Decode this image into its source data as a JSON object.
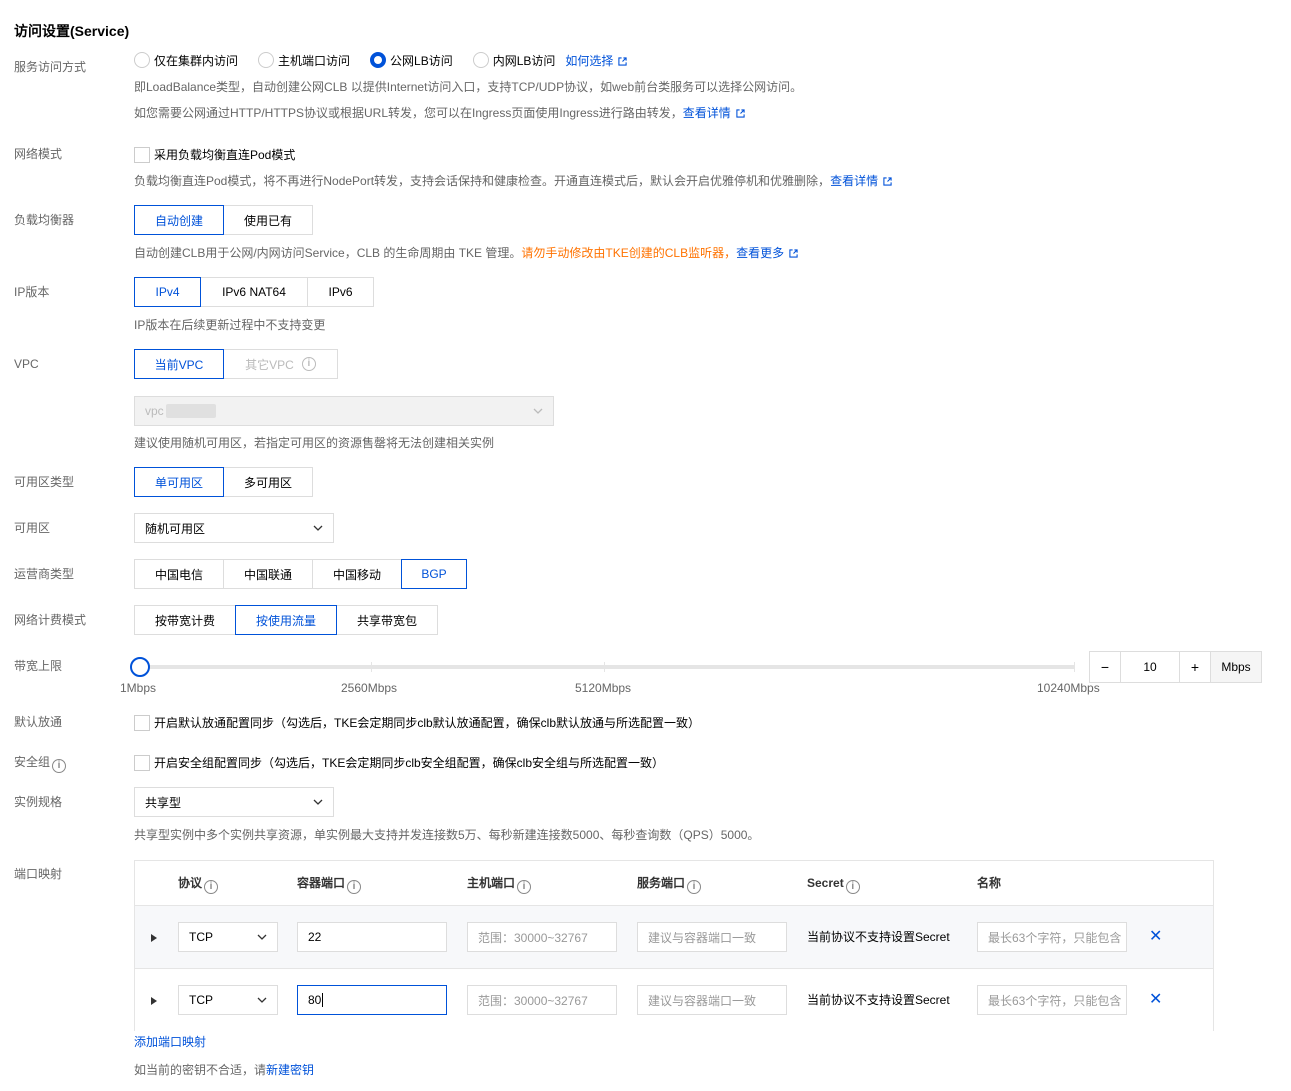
{
  "section_title": "访问设置(Service)",
  "labels": {
    "access_mode": "服务访问方式",
    "network_mode": "网络模式",
    "load_balancer": "负载均衡器",
    "ip_version": "IP版本",
    "vpc": "VPC",
    "zone_type": "可用区类型",
    "zone": "可用区",
    "isp_type": "运营商类型",
    "billing_mode": "网络计费模式",
    "bandwidth_limit": "带宽上限",
    "default_allow": "默认放通",
    "security_group": "安全组",
    "instance_spec": "实例规格",
    "port_mapping": "端口映射"
  },
  "access_mode": {
    "options": [
      "仅在集群内访问",
      "主机端口访问",
      "公网LB访问",
      "内网LB访问"
    ],
    "selected_index": 2,
    "help_link": "如何选择",
    "desc1": "即LoadBalance类型，自动创建公网CLB 以提供Internet访问入口，支持TCP/UDP协议，如web前台类服务可以选择公网访问。",
    "desc2": "如您需要公网通过HTTP/HTTPS协议或根据URL转发，您可以在Ingress页面使用Ingress进行路由转发，",
    "desc2_link": "查看详情"
  },
  "network_mode": {
    "checkbox_label": "采用负载均衡直连Pod模式",
    "desc": "负载均衡直连Pod模式，将不再进行NodePort转发，支持会话保持和健康检查。开通直连模式后，默认会开启优雅停机和优雅删除，",
    "desc_link": "查看详情"
  },
  "load_balancer": {
    "options": [
      "自动创建",
      "使用已有"
    ],
    "selected_index": 0,
    "desc": "自动创建CLB用于公网/内网访问Service，CLB 的生命周期由 TKE 管理。",
    "warning": "请勿手动修改由TKE创建的CLB监听器，",
    "desc_link": "查看更多"
  },
  "ip_version": {
    "options": [
      "IPv4",
      "IPv6 NAT64",
      "IPv6"
    ],
    "selected_index": 0,
    "desc": "IP版本在后续更新过程中不支持变更"
  },
  "vpc": {
    "options": [
      "当前VPC",
      "其它VPC"
    ],
    "selected_index": 0,
    "select_value_prefix": "vpc",
    "desc": "建议使用随机可用区，若指定可用区的资源售罄将无法创建相关实例"
  },
  "zone_type": {
    "options": [
      "单可用区",
      "多可用区"
    ],
    "selected_index": 0
  },
  "zone": {
    "value": "随机可用区"
  },
  "isp_type": {
    "options": [
      "中国电信",
      "中国联通",
      "中国移动",
      "BGP"
    ],
    "selected_index": 3
  },
  "billing_mode": {
    "options": [
      "按带宽计费",
      "按使用流量",
      "共享带宽包"
    ],
    "selected_index": 1
  },
  "bandwidth": {
    "ticks": [
      "1Mbps",
      "2560Mbps",
      "5120Mbps",
      "10240Mbps"
    ],
    "value": "10",
    "unit": "Mbps",
    "minus": "−",
    "plus": "+"
  },
  "default_allow": {
    "checkbox_label": "开启默认放通配置同步（勾选后，TKE会定期同步clb默认放通配置，确保clb默认放通与所选配置一致）"
  },
  "security_group": {
    "checkbox_label": "开启安全组配置同步（勾选后，TKE会定期同步clb安全组配置，确保clb安全组与所选配置一致）"
  },
  "instance_spec": {
    "value": "共享型",
    "desc": "共享型实例中多个实例共享资源，单实例最大支持并发连接数5万、每秒新建连接数5000、每秒查询数（QPS）5000。"
  },
  "port_table": {
    "headers": [
      "协议",
      "容器端口",
      "主机端口",
      "服务端口",
      "Secret",
      "名称"
    ],
    "rows": [
      {
        "protocol": "TCP",
        "container_port": "22",
        "host_port_ph": "范围：30000~32767",
        "service_port_ph": "建议与容器端口一致",
        "secret": "当前协议不支持设置Secret",
        "name_ph": "最长63个字符，只能包含"
      },
      {
        "protocol": "TCP",
        "container_port": "80",
        "host_port_ph": "范围：30000~32767",
        "service_port_ph": "建议与容器端口一致",
        "secret": "当前协议不支持设置Secret",
        "name_ph": "最长63个字符，只能包含"
      }
    ],
    "add_link": "添加端口映射"
  },
  "footer": {
    "text": "如当前的密钥不合适，请",
    "link": "新建密钥"
  },
  "colors": {
    "primary": "#0052d9",
    "warning": "#ff7200",
    "muted": "#666666"
  }
}
